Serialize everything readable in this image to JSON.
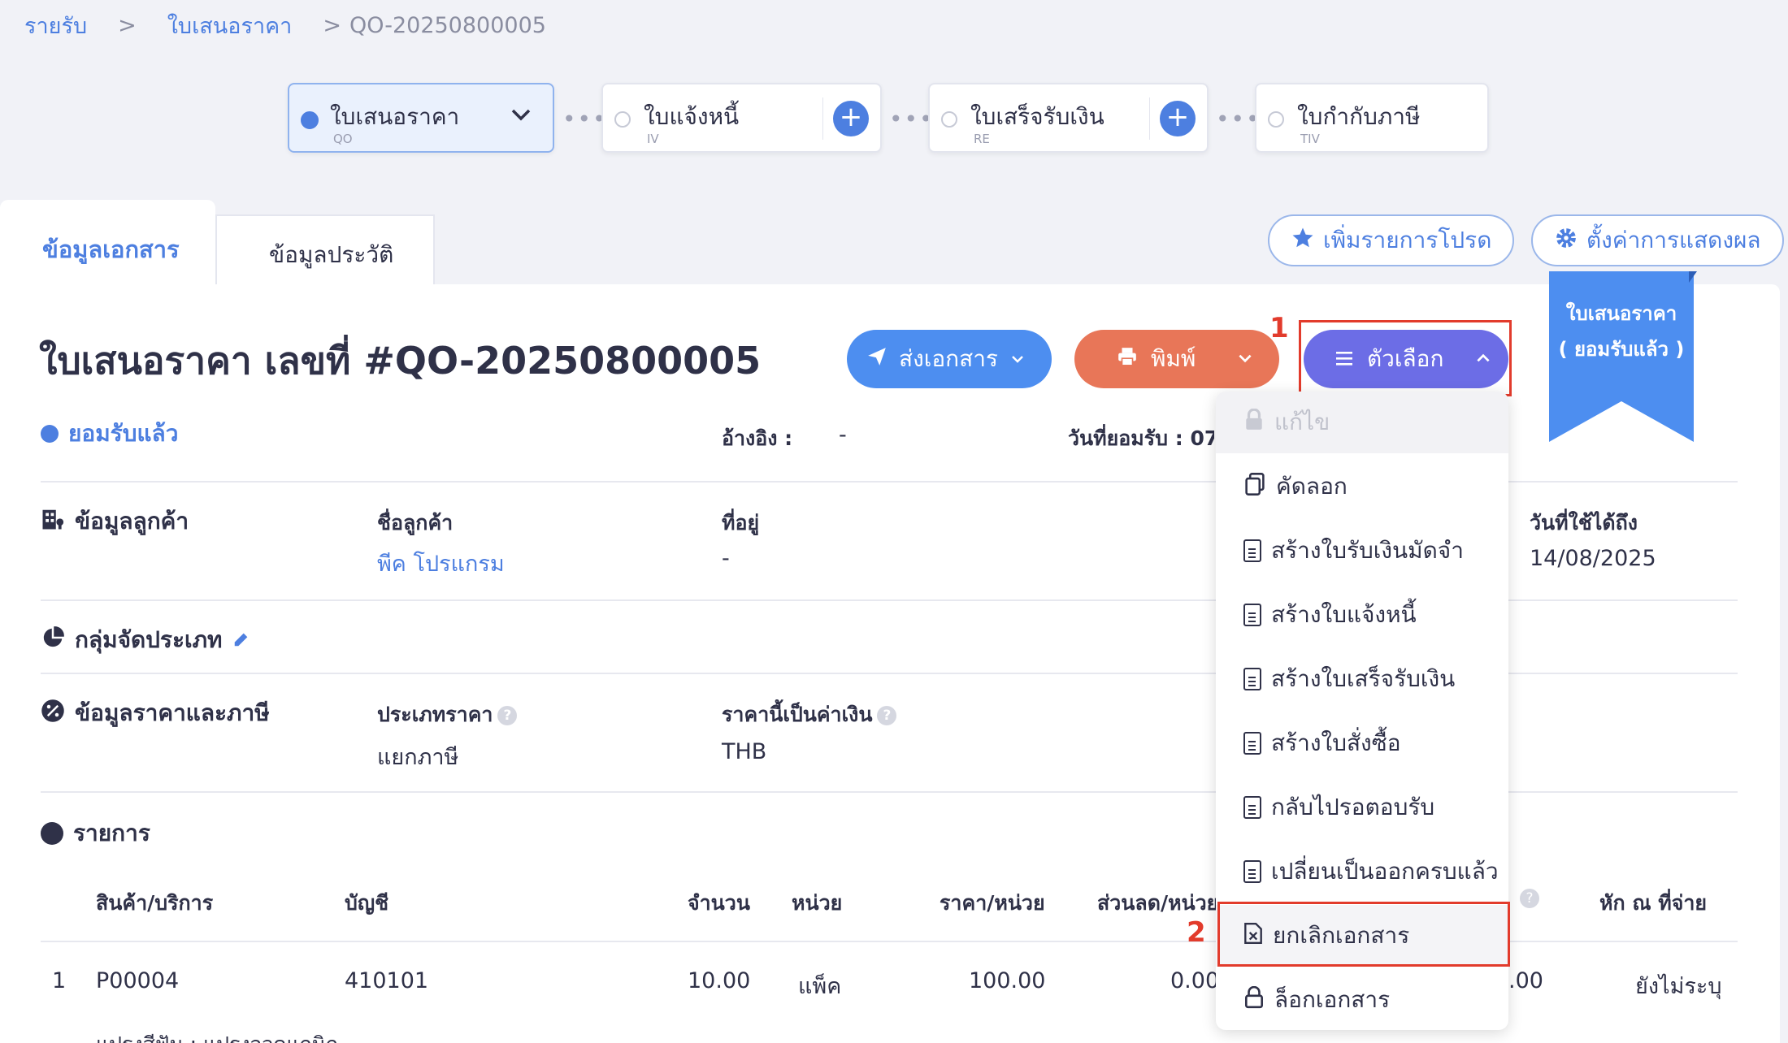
{
  "breadcrumb": {
    "root": "รายรับ",
    "section": "ใบเสนอราคา",
    "current": "QO-20250800005",
    "sep": ">"
  },
  "stepper": [
    {
      "label": "ใบเสนอราคา",
      "code": "QO"
    },
    {
      "label": "ใบแจ้งหนี้",
      "code": "IV"
    },
    {
      "label": "ใบเสร็จรับเงิน",
      "code": "RE"
    },
    {
      "label": "ใบกำกับภาษี",
      "code": "TIV"
    }
  ],
  "tabs": {
    "doc_info": "ข้อมูลเอกสาร",
    "history": "ข้อมูลประวัติ"
  },
  "top_actions": {
    "favorite": "เพิ่มรายการโปรด",
    "display_settings": "ตั้งค่าการแสดงผล"
  },
  "ribbon": {
    "line1": "ใบเสนอราคา",
    "line2": "( ยอมรับแล้ว )"
  },
  "document": {
    "title": "ใบเสนอราคา เลขที่ #QO-20250800005",
    "status": "ยอมรับแล้ว",
    "reference_label": "อ้างอิง :",
    "reference_value": "-",
    "accepted_date_label": "วันที่ยอมรับ : 07"
  },
  "buttons": {
    "send": "ส่งเอกสาร",
    "print": "พิมพ์",
    "options": "ตัวเลือก"
  },
  "annotations": {
    "step1": "1",
    "step2": "2"
  },
  "customer": {
    "section": "ข้อมูลลูกค้า",
    "name_label": "ชื่อลูกค้า",
    "name_value": "พีค โปรแกรม",
    "address_label": "ที่อยู่",
    "address_value": "-",
    "valid_until_label": "วันที่ใช้ได้ถึง",
    "valid_until_value": "14/08/2025"
  },
  "grouping": {
    "section": "กลุ่มจัดประเภท"
  },
  "pricing": {
    "section": "ข้อมูลราคาและภาษี",
    "price_type_label": "ประเภทราคา",
    "price_type_value": "แยกภาษี",
    "currency_label": "ราคานี้เป็นค่าเงิน",
    "currency_value": "THB"
  },
  "items": {
    "section": "รายการ",
    "headers": [
      "สินค้า/บริการ",
      "บัญชี",
      "จำนวน",
      "หน่วย",
      "ราคา/หน่วย",
      "ส่วนลด/หน่วย",
      "หัก ณ ที่จ่าย"
    ],
    "rows": [
      {
        "no": "1",
        "product": "P00004",
        "account": "410101",
        "qty": "10.00",
        "unit": "แพ็ค",
        "price": "100.00",
        "discount": "0.00",
        "vat": ".00",
        "wht": "ยังไม่ระบุ"
      }
    ],
    "row_note": "แปรงสีฟัน : แปรงจวดแกนิก"
  },
  "options_menu": [
    {
      "label": "แก้ไข",
      "icon": "lock-icon",
      "disabled": true
    },
    {
      "label": "คัดลอก",
      "icon": "copy-icon"
    },
    {
      "label": "สร้างใบรับเงินมัดจำ",
      "icon": "document-icon"
    },
    {
      "label": "สร้างใบแจ้งหนี้",
      "icon": "document-icon"
    },
    {
      "label": "สร้างใบเสร็จรับเงิน",
      "icon": "document-icon"
    },
    {
      "label": "สร้างใบสั่งซื้อ",
      "icon": "document-icon"
    },
    {
      "label": "กลับไปรอตอบรับ",
      "icon": "document-icon"
    },
    {
      "label": "เปลี่ยนเป็นออกครบแล้ว",
      "icon": "document-icon"
    },
    {
      "label": "ยกเลิกเอกสาร",
      "icon": "cancel-document-icon",
      "highlighted": true
    },
    {
      "label": "ล็อกเอกสาร",
      "icon": "lock-icon"
    }
  ],
  "colors": {
    "primary": "#4d7fe0",
    "print": "#e87658",
    "options": "#6c6de6",
    "annotation": "#e23b2c"
  }
}
